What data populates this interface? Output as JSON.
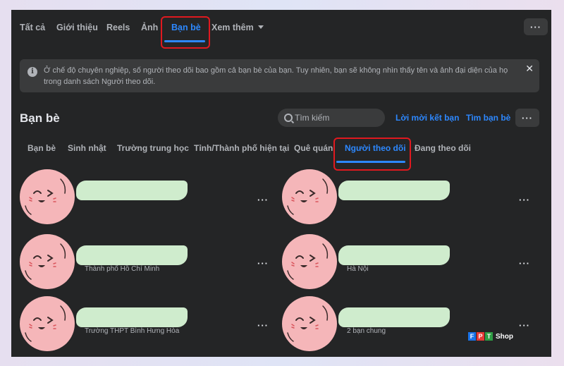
{
  "top_tabs": [
    "Tất cả",
    "Giới thiệu",
    "Reels",
    "Ảnh",
    "Bạn bè",
    "Xem thêm"
  ],
  "active_top_tab": "Bạn bè",
  "notice": {
    "text": "Ở chế độ chuyên nghiệp, số người theo dõi bao gồm cả bạn bè của bạn. Tuy nhiên, bạn sẽ không nhìn thấy tên và ảnh đại diện của họ trong danh sách Người theo dõi."
  },
  "section": {
    "title": "Bạn bè",
    "search_placeholder": "Tìm kiếm",
    "invite_label": "Lời mời kết bạn",
    "find_label": "Tìm bạn bè"
  },
  "sub_tabs": [
    "Bạn bè",
    "Sinh nhật",
    "Trường trung học",
    "Tỉnh/Thành phố hiện tại",
    "Quê quán",
    "Người theo dõi",
    "Đang theo dõi"
  ],
  "active_sub_tab": "Người theo dõi",
  "friends": [
    {
      "subtitle": ""
    },
    {
      "subtitle": ""
    },
    {
      "subtitle": "Thành phố Hồ Chí Minh"
    },
    {
      "subtitle": "Hà Nội"
    },
    {
      "subtitle": "Trường THPT Bình Hưng Hòa"
    },
    {
      "subtitle": "2 bạn chung"
    }
  ],
  "more_glyph": "···",
  "close_glyph": "✕",
  "info_glyph": "i",
  "watermark": {
    "letters": [
      "F",
      "P",
      "T"
    ],
    "shop": "Shop"
  },
  "colors": {
    "background": "#242526",
    "surface": "#3a3b3c",
    "accent": "#2d88ff",
    "highlight": "#e0191f",
    "avatar": "#f5b6b9",
    "redaction": "#cfeccd"
  }
}
